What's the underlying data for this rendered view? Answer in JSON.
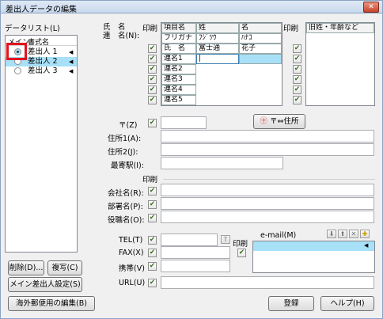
{
  "window": {
    "title": "差出人データの編集",
    "close": "✕"
  },
  "datalist": {
    "label": "データリスト(L)",
    "col_main": "メイン",
    "col_name": "書式名",
    "items": [
      {
        "name": "差出人 1",
        "selected": true
      },
      {
        "name": "差出人 2",
        "highlighted": true
      },
      {
        "name": "差出人 3"
      }
    ],
    "delete": "削除(D)...",
    "copy": "複写(C)",
    "set_main": "メイン差出人設定(S)"
  },
  "name_section": {
    "label_top": "氏　名",
    "label_bottom": "連　名(N):",
    "print_label": "印刷",
    "print2_label": "印刷",
    "col_item": "項目名",
    "col_last": "姓",
    "col_first": "名",
    "col_old": "旧姓・年齢など",
    "rows": [
      {
        "item": "フリガナ",
        "last": "ﾌｼﾞﾂｳ",
        "first": "ﾊﾅｺ"
      },
      {
        "item": "氏　名",
        "last": "富士通",
        "first": "花子"
      },
      {
        "item": "連名1",
        "last": "|",
        "first": ""
      },
      {
        "item": "連名2",
        "last": "",
        "first": ""
      },
      {
        "item": "連名3",
        "last": "",
        "first": ""
      },
      {
        "item": "連名4",
        "last": "",
        "first": ""
      },
      {
        "item": "連名5",
        "last": "",
        "first": ""
      }
    ]
  },
  "address": {
    "zip_label": "〒(Z)",
    "zip_value": "",
    "zip_button": "〒⇔住所",
    "addr1_label": "住所1(A):",
    "addr2_label": "住所2(J):",
    "station_label": "最寄駅(I):"
  },
  "company": {
    "print_label": "印刷",
    "company_label": "会社名(R):",
    "dept_label": "部署名(P):",
    "title_label": "役職名(O):"
  },
  "contact": {
    "tel_label": "TEL(T)",
    "fax_label": "FAX(X)",
    "mobile_label": "携帯(V)",
    "url_label": "URL(U)",
    "print_label": "印刷",
    "email_label": "e-mail(M)",
    "tel_btn": "T"
  },
  "footer": {
    "overseas": "海外郵便用の編集(B)",
    "register": "登録",
    "help": "ヘルプ(H)"
  }
}
